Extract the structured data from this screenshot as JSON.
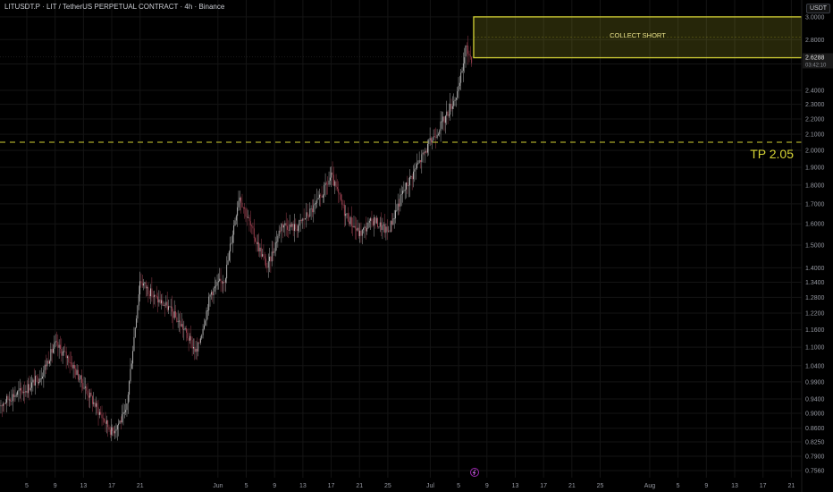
{
  "header": {
    "title": "LITUSDT.P · LIT / TetherUS PERPETUAL CONTRACT · 4h · Binance",
    "currency": "USDT"
  },
  "colors": {
    "background": "#000000",
    "grid": "#141414",
    "candle": "#c8c8c8",
    "candle_down": "#b0495a",
    "zone": "#d4d234",
    "line": "#d4d234",
    "axis_text": "#9598a1"
  },
  "chart_data": {
    "type": "candlestick",
    "title": "LITUSDT.P · LIT / TetherUS PERPETUAL CONTRACT · 4h · Binance",
    "interval": "4h",
    "y_scale": "log",
    "ylim": [
      0.74,
      3.04
    ],
    "y_ticks": [
      "3.0000",
      "2.8000",
      "2.6000",
      "2.4000",
      "2.3000",
      "2.2000",
      "2.1000",
      "2.0000",
      "1.9000",
      "1.8000",
      "1.7000",
      "1.6000",
      "1.5000",
      "1.4000",
      "1.3400",
      "1.2800",
      "1.2200",
      "1.1600",
      "1.1000",
      "1.0400",
      "0.9900",
      "0.9400",
      "0.9000",
      "0.8600",
      "0.8250",
      "0.7900",
      "0.7560"
    ],
    "x_ticks": [
      "5",
      "9",
      "13",
      "17",
      "21",
      "Jun",
      "5",
      "9",
      "13",
      "17",
      "21",
      "25",
      "Jul",
      "5",
      "9",
      "13",
      "17",
      "21",
      "25",
      "Aug",
      "5",
      "9",
      "13",
      "17",
      "21"
    ],
    "price_path": [
      {
        "date": "May 1",
        "value": 0.92
      },
      {
        "date": "May 3",
        "value": 0.95
      },
      {
        "date": "May 5",
        "value": 0.97
      },
      {
        "date": "May 7",
        "value": 1.01
      },
      {
        "date": "May 9",
        "value": 1.11
      },
      {
        "date": "May 11",
        "value": 1.06
      },
      {
        "date": "May 13",
        "value": 0.98
      },
      {
        "date": "May 15",
        "value": 0.91
      },
      {
        "date": "May 17",
        "value": 0.85
      },
      {
        "date": "May 19",
        "value": 0.9
      },
      {
        "date": "May 21",
        "value": 1.35
      },
      {
        "date": "May 23",
        "value": 1.28
      },
      {
        "date": "May 25",
        "value": 1.24
      },
      {
        "date": "May 27",
        "value": 1.17
      },
      {
        "date": "May 29",
        "value": 1.08
      },
      {
        "date": "May 31",
        "value": 1.3
      },
      {
        "date": "Jun 2",
        "value": 1.36
      },
      {
        "date": "Jun 4",
        "value": 1.75
      },
      {
        "date": "Jun 6",
        "value": 1.55
      },
      {
        "date": "Jun 8",
        "value": 1.4
      },
      {
        "date": "Jun 10",
        "value": 1.6
      },
      {
        "date": "Jun 12",
        "value": 1.58
      },
      {
        "date": "Jun 15",
        "value": 1.7
      },
      {
        "date": "Jun 17",
        "value": 1.85
      },
      {
        "date": "Jun 19",
        "value": 1.65
      },
      {
        "date": "Jun 21",
        "value": 1.55
      },
      {
        "date": "Jun 23",
        "value": 1.62
      },
      {
        "date": "Jun 25",
        "value": 1.56
      },
      {
        "date": "Jun 27",
        "value": 1.75
      },
      {
        "date": "Jun 29",
        "value": 1.9
      },
      {
        "date": "Jul 1",
        "value": 2.05
      },
      {
        "date": "Jul 3",
        "value": 2.2
      },
      {
        "date": "Jul 5",
        "value": 2.4
      },
      {
        "date": "Jul 6",
        "value": 2.73
      },
      {
        "date": "Jul 7",
        "value": 2.6288
      }
    ],
    "low_point": {
      "date": "May 17",
      "value": 0.84
    },
    "last_price": {
      "value": "2.6288",
      "countdown": "03:42:10"
    },
    "zone": {
      "label": "COLLECT SHORT",
      "from_date": "Jul 7",
      "to_date": "Aug 23",
      "low": 2.65,
      "high": 3.0
    },
    "target_line": {
      "value": 2.05,
      "axis_label": "2.0500",
      "label": "TP 2.05"
    }
  }
}
